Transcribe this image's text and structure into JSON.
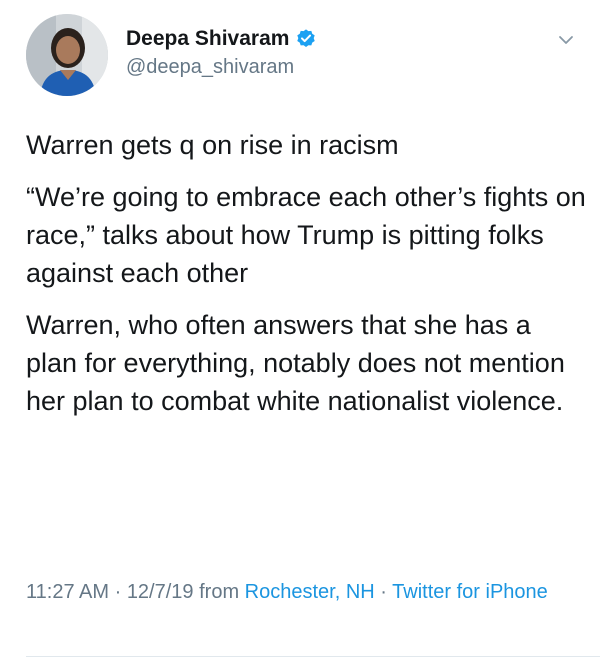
{
  "author": {
    "display_name": "Deepa Shivaram",
    "handle": "@deepa_shivaram",
    "verified": true,
    "verified_icon": "verified-badge-icon"
  },
  "tweet": {
    "paragraphs": [
      "Warren gets q on rise in racism",
      "“We’re going to embrace each other’s fights on race,” talks about how Trump is pitting folks against each other",
      "Warren, who often answers that she has a plan for everything, notably does not mention her plan to combat white nationalist violence."
    ],
    "time": "11:27 AM",
    "date": "12/7/19",
    "separator": " · ",
    "from_label": " from ",
    "location": "Rochester, NH",
    "source": "Twitter for iPhone"
  },
  "colors": {
    "text": "#14171a",
    "secondary": "#657786",
    "link": "#1b95e0",
    "verified": "#1da1f2"
  }
}
